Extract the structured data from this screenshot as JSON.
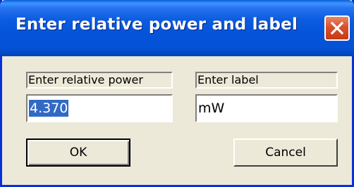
{
  "window": {
    "title": "Enter relative power and label"
  },
  "fields": {
    "power_label": "Enter relative power",
    "power_value": "4.370",
    "label_label": "Enter label",
    "label_value": "mW"
  },
  "buttons": {
    "ok": "OK",
    "cancel": "Cancel"
  },
  "icons": {
    "close": "close-icon"
  },
  "colors": {
    "titlebar": "#0453d9",
    "window_bg": "#ece9d8",
    "close_button": "#d9512b",
    "selection": "#316ac5"
  }
}
